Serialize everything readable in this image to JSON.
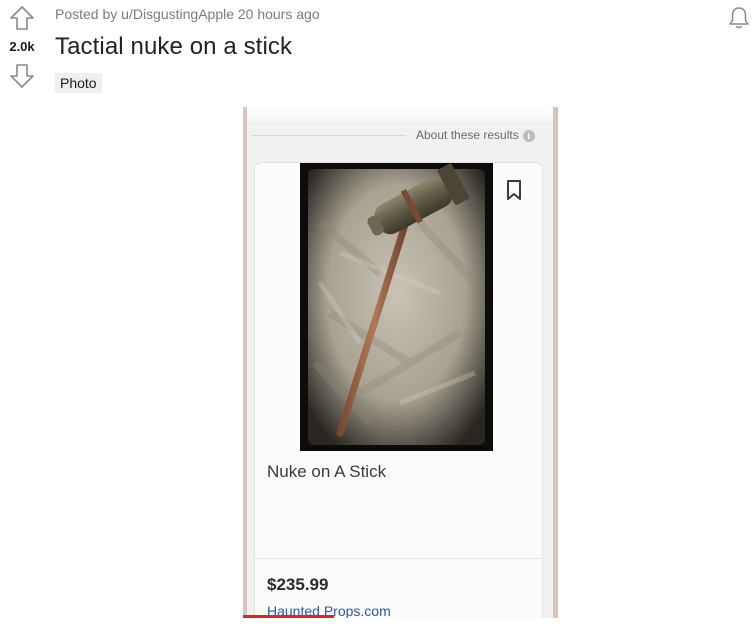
{
  "post": {
    "score": "2.0k",
    "posted_by": "Posted by u/DisgustingApple 20 hours ago",
    "title": "Tactial nuke on a stick",
    "flair": "Photo"
  },
  "icons": {
    "upvote": "arrow-up-icon",
    "downvote": "arrow-down-icon",
    "notify": "bell-icon",
    "info": "info-icon",
    "bookmark": "bookmark-icon"
  },
  "media": {
    "about_text": "About these results",
    "info_glyph": "i",
    "product_name": "Nuke on A Stick",
    "price": "$235.99",
    "seller": "Haunted Props.com",
    "video_progress": 0.29
  },
  "colors": {
    "meta_text": "#787c7e",
    "link": "#2a55b8",
    "progress": "#e02323"
  }
}
